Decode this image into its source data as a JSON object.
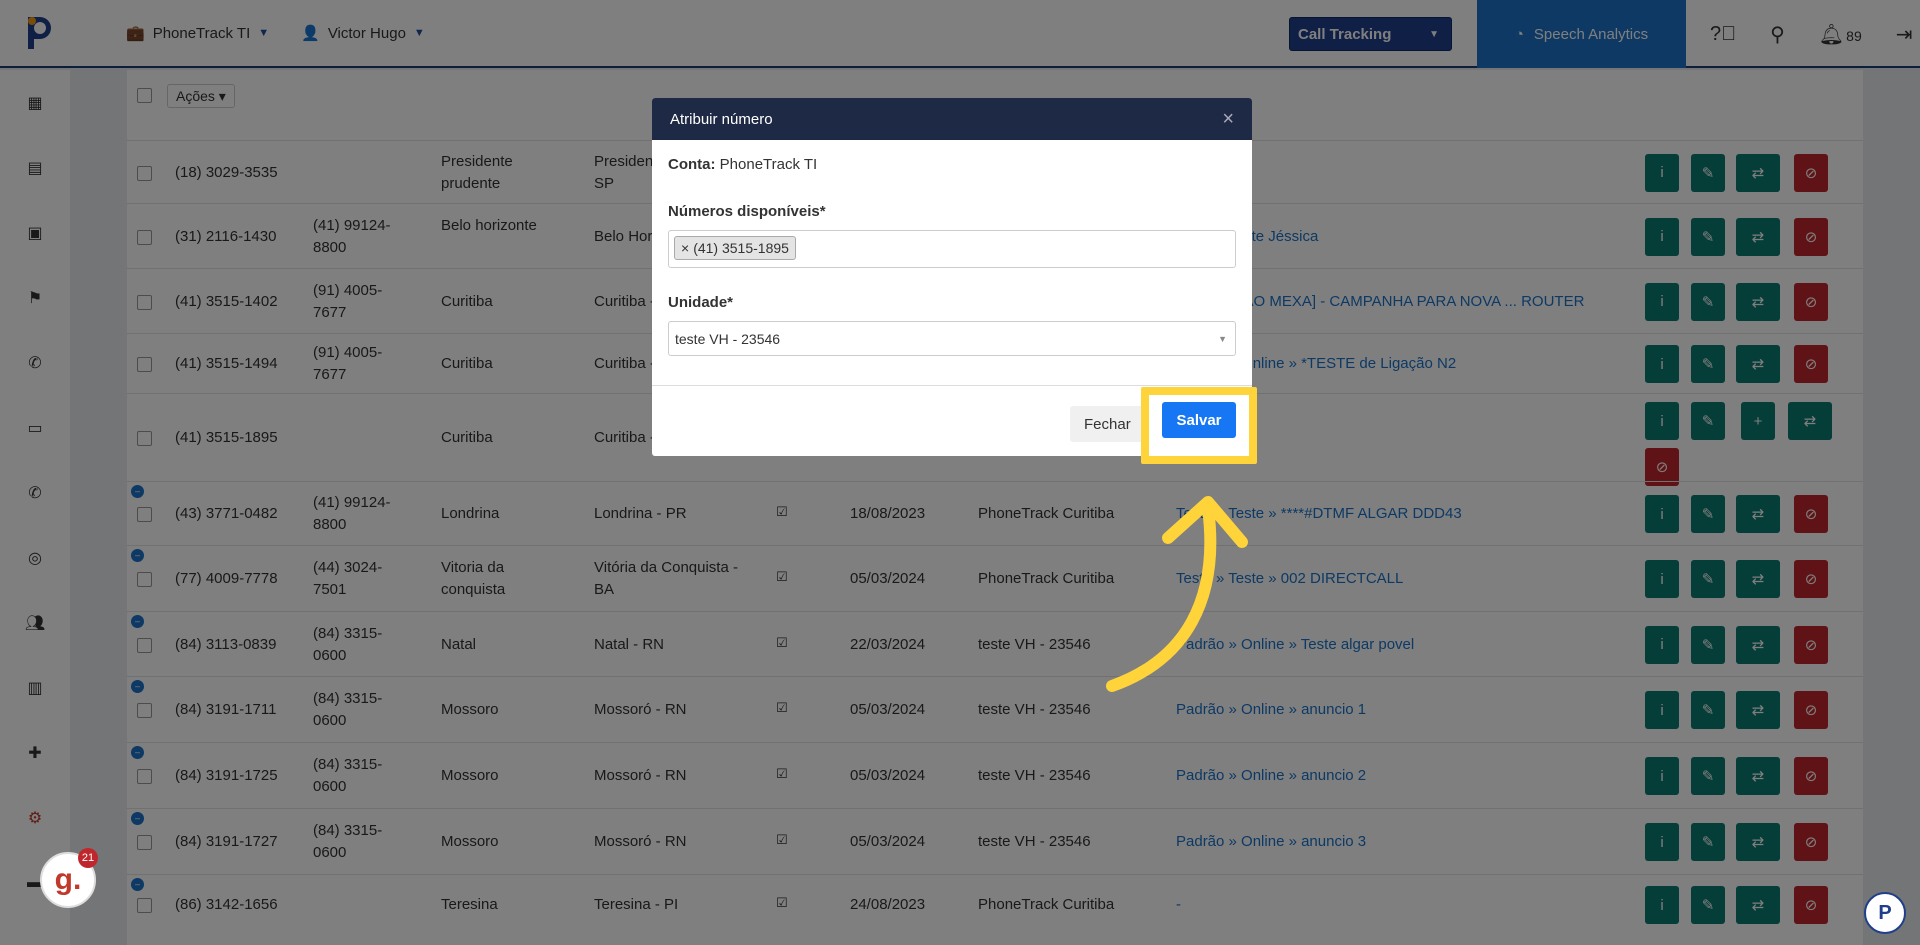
{
  "topbar": {
    "account": "PhoneTrack TI",
    "user": "Victor Hugo",
    "product_select": "Call Tracking",
    "speech_analytics": "Speech Analytics",
    "notification_count": "89"
  },
  "table": {
    "actions_label": "Ações",
    "rows": [
      {
        "num": "(18) 3029-3535",
        "redir": "",
        "city": "Presidente prudente",
        "region": "Presidente Prudente - SP",
        "date": "",
        "unit": "",
        "path": ""
      },
      {
        "num": "(31) 2116-1430",
        "redir": "(41) 99124-8800",
        "city": "Belo horizonte",
        "region": "Belo Horizonte - MG",
        "date": "",
        "unit": "",
        "path": "Teste » Teste Jéssica"
      },
      {
        "num": "(41) 3515-1402",
        "redir": "(91) 4005-7677",
        "city": "Curitiba",
        "region": "Curitiba - PR",
        "date": "",
        "unit": "",
        "path": "Teste » [NÃO MEXA] - CAMPANHA PARA NOVA ... ROUTER"
      },
      {
        "num": "(41) 3515-1494",
        "redir": "(91) 4005-7677",
        "city": "Curitiba",
        "region": "Curitiba - PR",
        "date": "",
        "unit": "",
        "path": "Padrão » Online » *TESTE de Ligação N2"
      },
      {
        "num": "(41) 3515-1895",
        "redir": "",
        "city": "Curitiba",
        "region": "Curitiba - PR",
        "date": "",
        "unit": "",
        "path": ""
      },
      {
        "num": "(43) 3771-0482",
        "redir": "(41) 99124-8800",
        "city": "Londrina",
        "region": "Londrina - PR",
        "date": "18/08/2023",
        "unit": "PhoneTrack Curitiba",
        "path": "Teste » Teste » ****#DTMF ALGAR DDD43"
      },
      {
        "num": "(77) 4009-7778",
        "redir": "(44) 3024-7501",
        "city": "Vitoria da conquista",
        "region": "Vitória da Conquista - BA",
        "date": "05/03/2024",
        "unit": "PhoneTrack Curitiba",
        "path": "Teste » Teste » 002 DIRECTCALL"
      },
      {
        "num": "(84) 3113-0839",
        "redir": "(84) 3315-0600",
        "city": "Natal",
        "region": "Natal - RN",
        "date": "22/03/2024",
        "unit": "teste VH - 23546",
        "path": "Padrão » Online » Teste algar povel"
      },
      {
        "num": "(84) 3191-1711",
        "redir": "(84) 3315-0600",
        "city": "Mossoro",
        "region": "Mossoró - RN",
        "date": "05/03/2024",
        "unit": "teste VH - 23546",
        "path": "Padrão » Online » anuncio 1"
      },
      {
        "num": "(84) 3191-1725",
        "redir": "(84) 3315-0600",
        "city": "Mossoro",
        "region": "Mossoró - RN",
        "date": "05/03/2024",
        "unit": "teste VH - 23546",
        "path": "Padrão » Online » anuncio 2"
      },
      {
        "num": "(84) 3191-1727",
        "redir": "(84) 3315-0600",
        "city": "Mossoro",
        "region": "Mossoró - RN",
        "date": "05/03/2024",
        "unit": "teste VH - 23546",
        "path": "Padrão » Online » anuncio 3"
      },
      {
        "num": "(86) 3142-1656",
        "redir": "",
        "city": "Teresina",
        "region": "Teresina - PI",
        "date": "24/08/2023",
        "unit": "PhoneTrack Curitiba",
        "path": "-"
      }
    ]
  },
  "modal": {
    "title": "Atribuir número",
    "conta_label": "Conta:",
    "conta_value": "PhoneTrack TI",
    "numeros_label": "Números disponíveis*",
    "numero_tag": "(41) 3515-1895",
    "unidade_label": "Unidade*",
    "unidade_value": "teste VH - 23546",
    "fechar": "Fechar",
    "salvar": "Salvar"
  },
  "widgets": {
    "g_badge_count": "21"
  },
  "colors": {
    "accent": "#1676f3",
    "highlight": "#ffd43b",
    "teal": "#0b7a70",
    "danger": "#c0272d"
  }
}
